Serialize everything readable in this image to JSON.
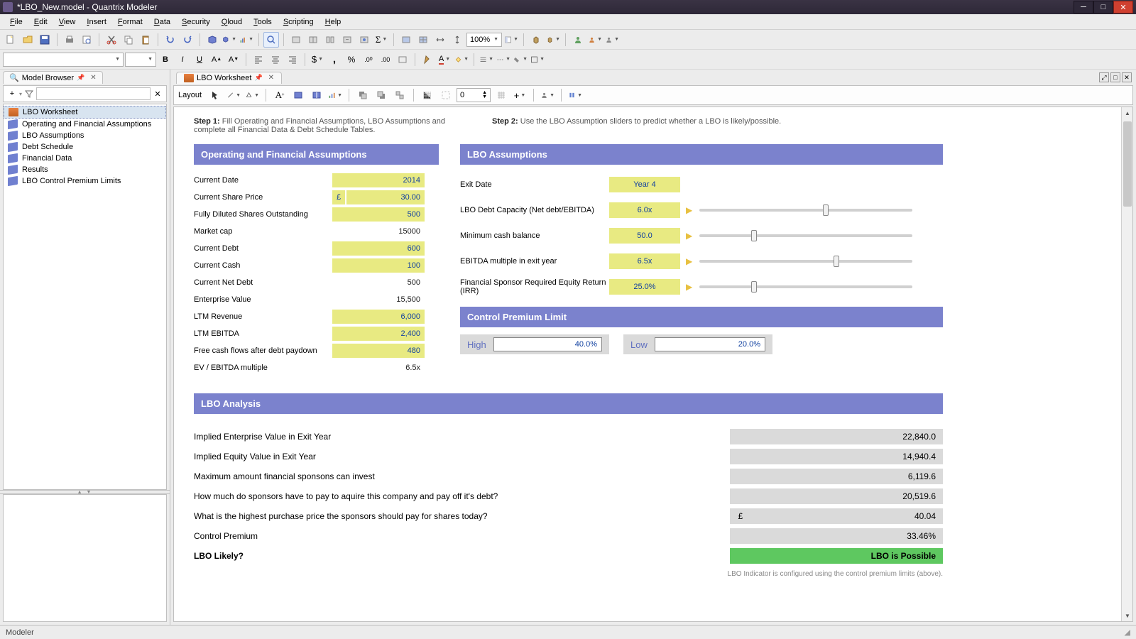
{
  "window": {
    "title": "*LBO_New.model - Quantrix Modeler"
  },
  "menu": [
    "File",
    "Edit",
    "View",
    "Insert",
    "Format",
    "Data",
    "Security",
    "Qloud",
    "Tools",
    "Scripting",
    "Help"
  ],
  "zoom": "100%",
  "browser": {
    "title": "Model Browser",
    "items": [
      {
        "label": "LBO Worksheet",
        "type": "ws",
        "selected": true
      },
      {
        "label": "Operating and Financial Assumptions",
        "type": "cube"
      },
      {
        "label": "LBO Assumptions",
        "type": "cube"
      },
      {
        "label": "Debt Schedule",
        "type": "cube"
      },
      {
        "label": "Financial Data",
        "type": "cube"
      },
      {
        "label": "Results",
        "type": "cube"
      },
      {
        "label": "LBO Control Premium Limits",
        "type": "cube"
      }
    ]
  },
  "worksheet": {
    "tab": "LBO Worksheet",
    "layoutLabel": "Layout",
    "spinner": "0",
    "step1_b": "Step 1:",
    "step1": " Fill Operating and Financial Assumptions, LBO Assumptions and complete all Financial Data & Debt Schedule Tables.",
    "step2_b": "Step 2:",
    "step2": " Use the LBO Assumption sliders to predict whether a LBO is likely/possible.",
    "ofa_title": "Operating and Financial Assumptions",
    "lboa_title": "LBO Assumptions",
    "cpl_title": "Control Premium Limit",
    "analysis_title": "LBO Analysis",
    "ofa": [
      {
        "label": "Current Date",
        "value": "2014",
        "editable": true
      },
      {
        "label": "Current Share Price",
        "prefix": "£",
        "value": "30.00",
        "editable": true
      },
      {
        "label": "Fully Diluted Shares Outstanding",
        "value": "500",
        "editable": true
      },
      {
        "label": "Market cap",
        "value": "15000",
        "editable": false
      },
      {
        "label": "Current Debt",
        "value": "600",
        "editable": true
      },
      {
        "label": "Current Cash",
        "value": "100",
        "editable": true
      },
      {
        "label": "Current Net Debt",
        "value": "500",
        "editable": false
      },
      {
        "label": "Enterprise Value",
        "value": "15,500",
        "editable": false
      },
      {
        "label": "LTM Revenue",
        "value": "6,000",
        "editable": true
      },
      {
        "label": "LTM EBITDA",
        "value": "2,400",
        "editable": true
      },
      {
        "label": "Free cash flows after debt paydown",
        "value": "480",
        "editable": true
      },
      {
        "label": "EV / EBITDA multiple",
        "value": "6.5x",
        "editable": false
      }
    ],
    "lboa": [
      {
        "label": "Exit Date",
        "value": "Year 4",
        "slider": false
      },
      {
        "label": "LBO Debt Capacity (Net debt/EBITDA)",
        "value": "6.0x",
        "slider": true,
        "pos": 60
      },
      {
        "label": "Minimum cash balance",
        "value": "50.0",
        "slider": true,
        "pos": 25
      },
      {
        "label": "EBITDA multiple in exit year",
        "value": "6.5x",
        "slider": true,
        "pos": 65
      },
      {
        "label": "Financial Sponsor Required Equity Return (IRR)",
        "value": "25.0%",
        "slider": true,
        "pos": 25
      }
    ],
    "cpl": {
      "highLabel": "High",
      "high": "40.0%",
      "lowLabel": "Low",
      "low": "20.0%"
    },
    "analysis": [
      {
        "label": "Implied Enterprise Value in Exit Year",
        "value": "22,840.0"
      },
      {
        "label": "Implied Equity Value in Exit Year",
        "value": "14,940.4"
      },
      {
        "label": "Maximum amount financial sponsons can invest",
        "value": "6,119.6"
      },
      {
        "label": "How much do sponsors have to pay to aquire this company and pay off it's debt?",
        "value": "20,519.6"
      },
      {
        "label": "What is the highest purchase price the sponsors should pay for shares today?",
        "prefix": "£",
        "value": "40.04"
      },
      {
        "label": "Control Premium",
        "value": "33.46%"
      },
      {
        "label": "LBO Likely?",
        "value": "LBO is Possible",
        "highlight": true
      }
    ],
    "footnote": "LBO Indicator is configured using the control premium limits (above)."
  },
  "status": "Modeler"
}
